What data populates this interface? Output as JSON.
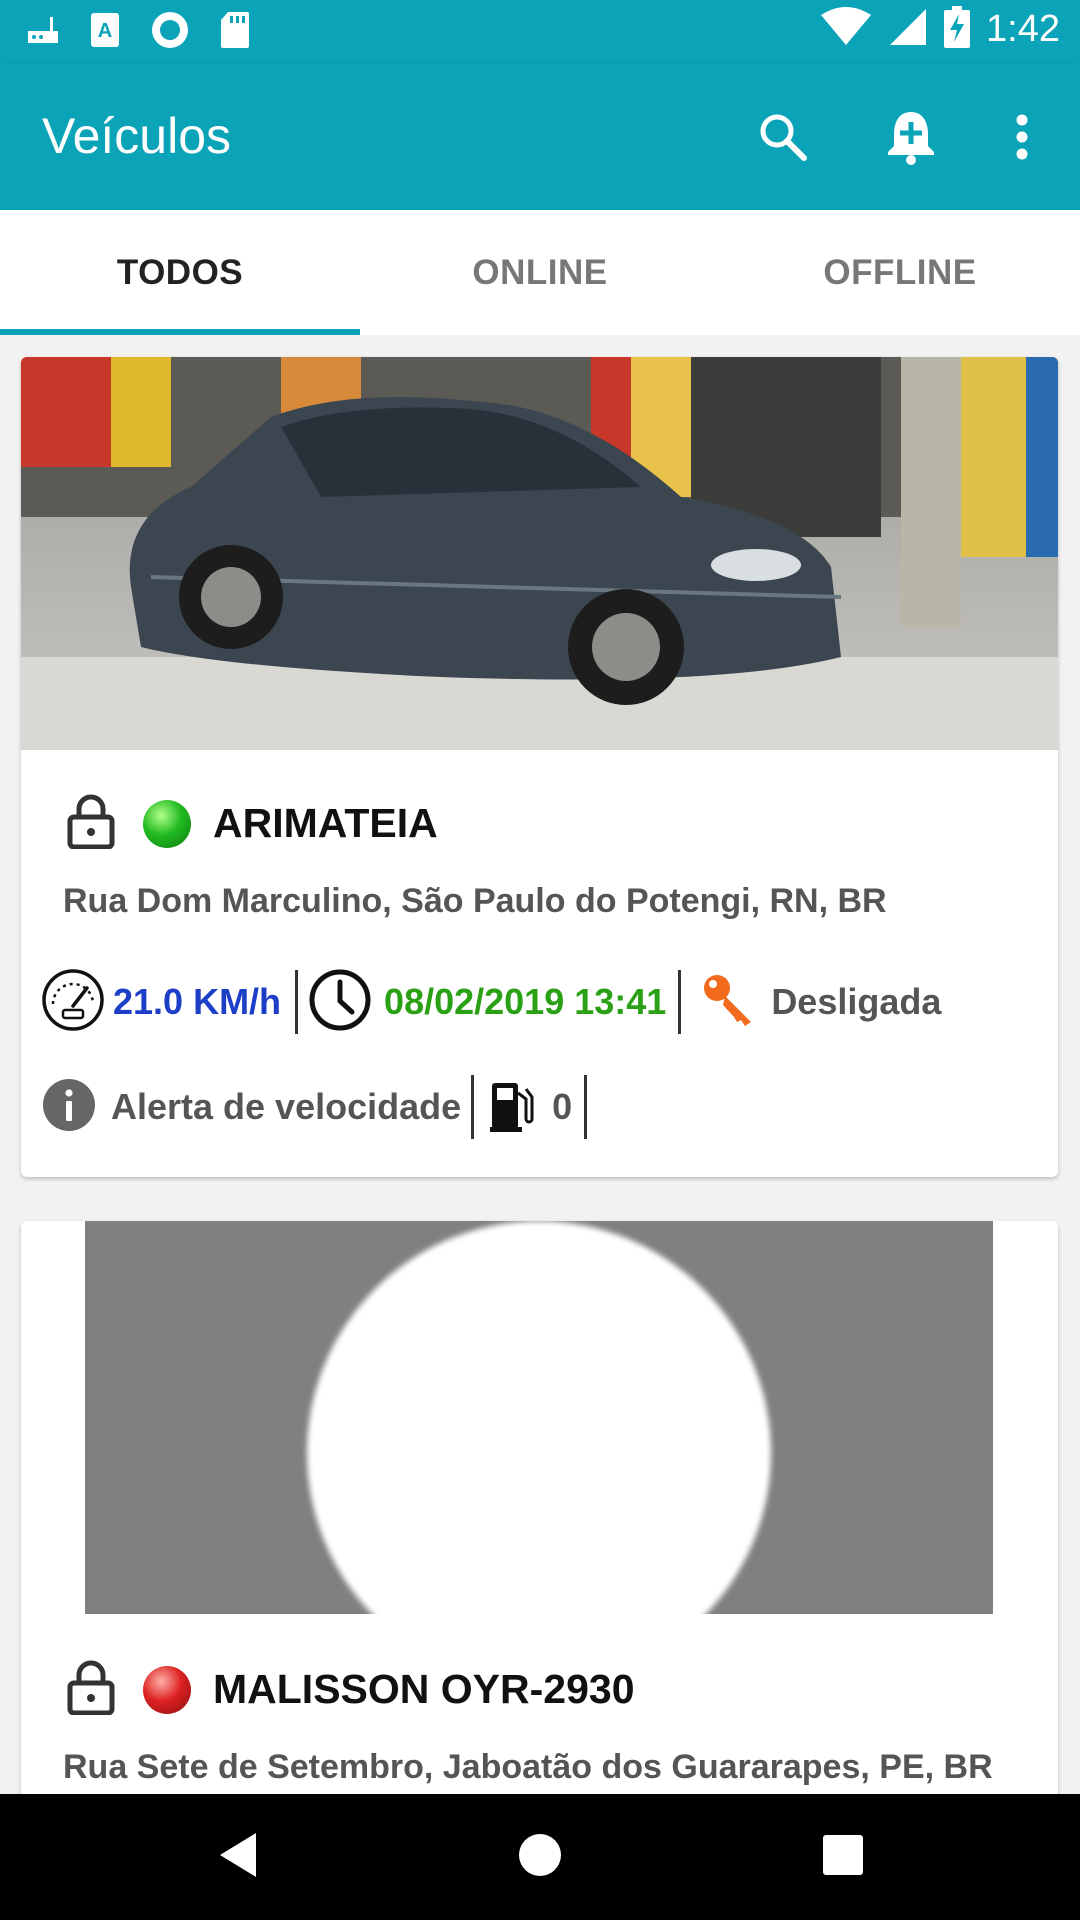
{
  "status_bar": {
    "time": "1:42",
    "left_icons": [
      "router-icon",
      "a-app-icon",
      "record-icon",
      "sd-card-icon"
    ],
    "right_icons": [
      "wifi-icon",
      "signal-icon",
      "battery-charging-icon"
    ]
  },
  "app_bar": {
    "title": "Veículos",
    "actions": [
      "search-icon",
      "add-alert-icon",
      "more-vert-icon"
    ],
    "color": "#0aa3b8"
  },
  "tabs": [
    {
      "label": "TODOS",
      "active": true
    },
    {
      "label": "ONLINE",
      "active": false
    },
    {
      "label": "OFFLINE",
      "active": false
    }
  ],
  "vehicles": [
    {
      "name": "ARIMATEIA",
      "status": "online",
      "status_color": "#22bb22",
      "address": "Rua Dom Marculino, São Paulo do Potengi, RN, BR",
      "speed": "21.0 KM/h",
      "speed_color": "#1d3fc8",
      "datetime": "08/02/2019 13:41",
      "datetime_color": "#2aa014",
      "ignition": "Desligada",
      "alert": "Alerta de velocidade",
      "fuel": "0"
    },
    {
      "name": "MALISSON OYR-2930",
      "status": "offline",
      "status_color": "#dd2222",
      "address": "Rua Sete de Setembro, Jaboatão dos Guararapes, PE, BR"
    }
  ],
  "nav_bar": [
    "back-icon",
    "home-icon",
    "recents-icon"
  ]
}
